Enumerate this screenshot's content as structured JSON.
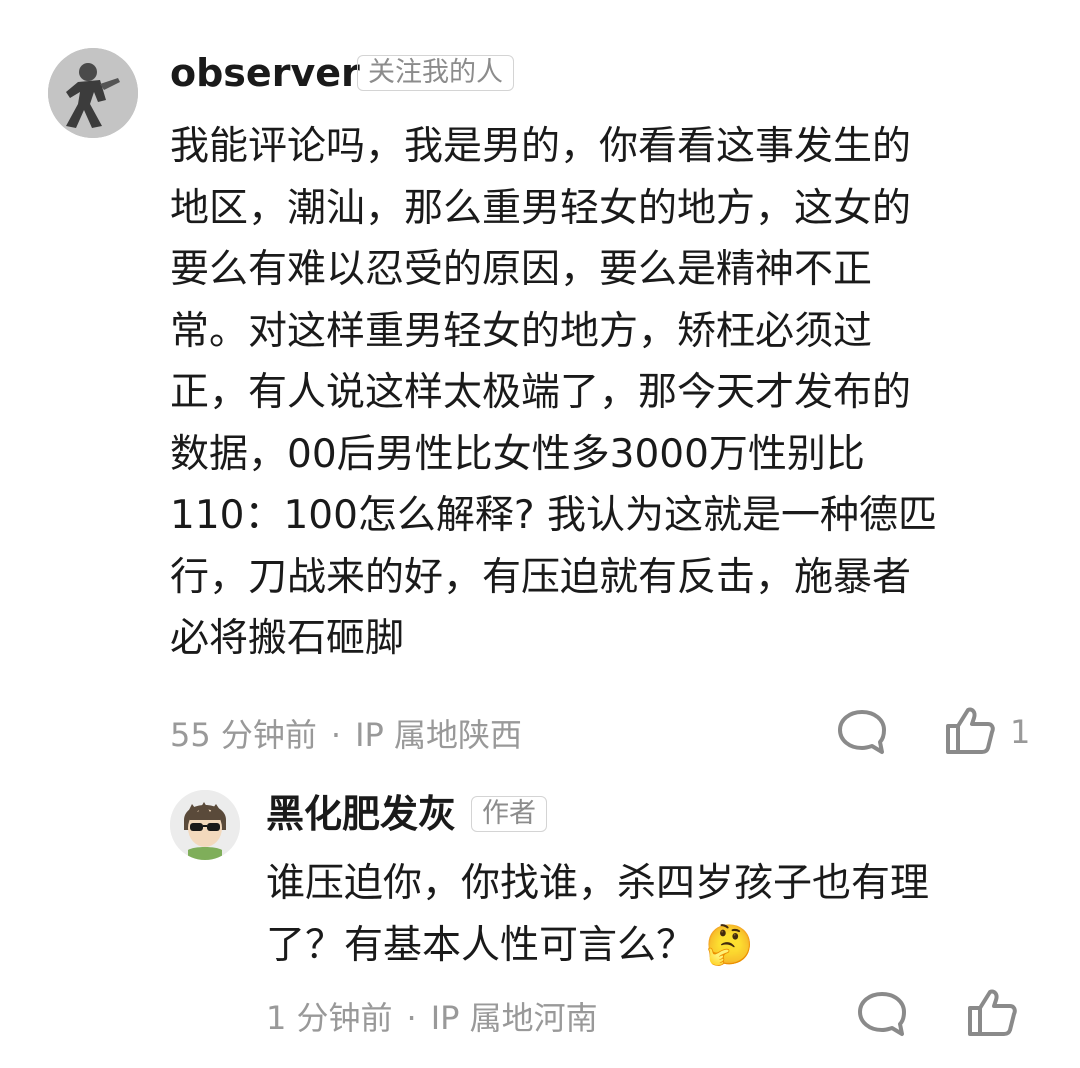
{
  "comment": {
    "author": "observer",
    "badge": "关注我的人",
    "text_lines": [
      "我能评论吗，我是男的，你看看这事发生的",
      "地区，潮汕，那么重男轻女的地方，这女的",
      "要么有难以忍受的原因，要么是精神不正",
      "常。对这样重男轻女的地方，矫枉必须过",
      "正，有人说这样太极端了，那今天才发布的",
      "数据，00后男性比女性多3000万性别比",
      "110：100怎么解释? 我认为这就是一种德匹",
      "行，刀战来的好，有压迫就有反击，施暴者",
      "必将搬石砸脚"
    ],
    "time": "55 分钟前",
    "separator": "·",
    "ip": "IP 属地陕西",
    "like_count": "1",
    "icons": {
      "reply": "comment-bubble-icon",
      "like": "thumbs-up-icon"
    }
  },
  "reply": {
    "author": "黑化肥发灰",
    "badge": "作者",
    "text_lines": [
      "谁压迫你，你找谁，杀四岁孩子也有理",
      "了？有基本人性可言么？"
    ],
    "emoji": "🤔",
    "time": "1 分钟前",
    "separator": "·",
    "ip": "IP 属地河南",
    "icons": {
      "reply": "comment-bubble-icon",
      "like": "thumbs-up-icon"
    }
  },
  "colors": {
    "text": "#1a1a1a",
    "meta": "#999999",
    "icon": "#8a8a8a",
    "badge_border": "#d4d4d4"
  }
}
